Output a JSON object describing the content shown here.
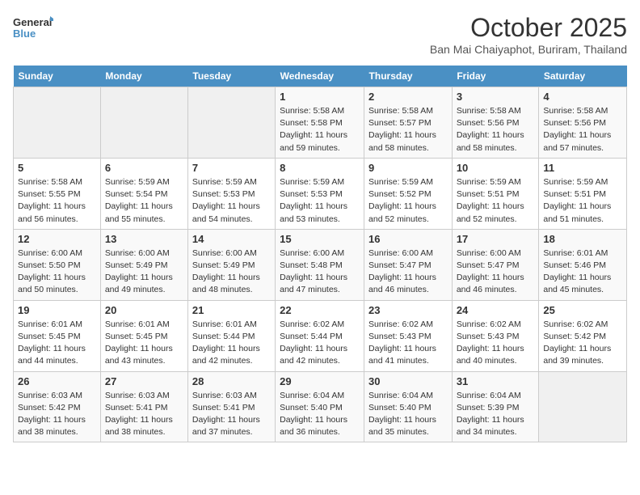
{
  "logo": {
    "line1": "General",
    "line2": "Blue"
  },
  "title": "October 2025",
  "location": "Ban Mai Chaiyaphot, Buriram, Thailand",
  "weekdays": [
    "Sunday",
    "Monday",
    "Tuesday",
    "Wednesday",
    "Thursday",
    "Friday",
    "Saturday"
  ],
  "weeks": [
    [
      {
        "day": "",
        "info": ""
      },
      {
        "day": "",
        "info": ""
      },
      {
        "day": "",
        "info": ""
      },
      {
        "day": "1",
        "info": "Sunrise: 5:58 AM\nSunset: 5:58 PM\nDaylight: 11 hours\nand 59 minutes."
      },
      {
        "day": "2",
        "info": "Sunrise: 5:58 AM\nSunset: 5:57 PM\nDaylight: 11 hours\nand 58 minutes."
      },
      {
        "day": "3",
        "info": "Sunrise: 5:58 AM\nSunset: 5:56 PM\nDaylight: 11 hours\nand 58 minutes."
      },
      {
        "day": "4",
        "info": "Sunrise: 5:58 AM\nSunset: 5:56 PM\nDaylight: 11 hours\nand 57 minutes."
      }
    ],
    [
      {
        "day": "5",
        "info": "Sunrise: 5:58 AM\nSunset: 5:55 PM\nDaylight: 11 hours\nand 56 minutes."
      },
      {
        "day": "6",
        "info": "Sunrise: 5:59 AM\nSunset: 5:54 PM\nDaylight: 11 hours\nand 55 minutes."
      },
      {
        "day": "7",
        "info": "Sunrise: 5:59 AM\nSunset: 5:53 PM\nDaylight: 11 hours\nand 54 minutes."
      },
      {
        "day": "8",
        "info": "Sunrise: 5:59 AM\nSunset: 5:53 PM\nDaylight: 11 hours\nand 53 minutes."
      },
      {
        "day": "9",
        "info": "Sunrise: 5:59 AM\nSunset: 5:52 PM\nDaylight: 11 hours\nand 52 minutes."
      },
      {
        "day": "10",
        "info": "Sunrise: 5:59 AM\nSunset: 5:51 PM\nDaylight: 11 hours\nand 52 minutes."
      },
      {
        "day": "11",
        "info": "Sunrise: 5:59 AM\nSunset: 5:51 PM\nDaylight: 11 hours\nand 51 minutes."
      }
    ],
    [
      {
        "day": "12",
        "info": "Sunrise: 6:00 AM\nSunset: 5:50 PM\nDaylight: 11 hours\nand 50 minutes."
      },
      {
        "day": "13",
        "info": "Sunrise: 6:00 AM\nSunset: 5:49 PM\nDaylight: 11 hours\nand 49 minutes."
      },
      {
        "day": "14",
        "info": "Sunrise: 6:00 AM\nSunset: 5:49 PM\nDaylight: 11 hours\nand 48 minutes."
      },
      {
        "day": "15",
        "info": "Sunrise: 6:00 AM\nSunset: 5:48 PM\nDaylight: 11 hours\nand 47 minutes."
      },
      {
        "day": "16",
        "info": "Sunrise: 6:00 AM\nSunset: 5:47 PM\nDaylight: 11 hours\nand 46 minutes."
      },
      {
        "day": "17",
        "info": "Sunrise: 6:00 AM\nSunset: 5:47 PM\nDaylight: 11 hours\nand 46 minutes."
      },
      {
        "day": "18",
        "info": "Sunrise: 6:01 AM\nSunset: 5:46 PM\nDaylight: 11 hours\nand 45 minutes."
      }
    ],
    [
      {
        "day": "19",
        "info": "Sunrise: 6:01 AM\nSunset: 5:45 PM\nDaylight: 11 hours\nand 44 minutes."
      },
      {
        "day": "20",
        "info": "Sunrise: 6:01 AM\nSunset: 5:45 PM\nDaylight: 11 hours\nand 43 minutes."
      },
      {
        "day": "21",
        "info": "Sunrise: 6:01 AM\nSunset: 5:44 PM\nDaylight: 11 hours\nand 42 minutes."
      },
      {
        "day": "22",
        "info": "Sunrise: 6:02 AM\nSunset: 5:44 PM\nDaylight: 11 hours\nand 42 minutes."
      },
      {
        "day": "23",
        "info": "Sunrise: 6:02 AM\nSunset: 5:43 PM\nDaylight: 11 hours\nand 41 minutes."
      },
      {
        "day": "24",
        "info": "Sunrise: 6:02 AM\nSunset: 5:43 PM\nDaylight: 11 hours\nand 40 minutes."
      },
      {
        "day": "25",
        "info": "Sunrise: 6:02 AM\nSunset: 5:42 PM\nDaylight: 11 hours\nand 39 minutes."
      }
    ],
    [
      {
        "day": "26",
        "info": "Sunrise: 6:03 AM\nSunset: 5:42 PM\nDaylight: 11 hours\nand 38 minutes."
      },
      {
        "day": "27",
        "info": "Sunrise: 6:03 AM\nSunset: 5:41 PM\nDaylight: 11 hours\nand 38 minutes."
      },
      {
        "day": "28",
        "info": "Sunrise: 6:03 AM\nSunset: 5:41 PM\nDaylight: 11 hours\nand 37 minutes."
      },
      {
        "day": "29",
        "info": "Sunrise: 6:04 AM\nSunset: 5:40 PM\nDaylight: 11 hours\nand 36 minutes."
      },
      {
        "day": "30",
        "info": "Sunrise: 6:04 AM\nSunset: 5:40 PM\nDaylight: 11 hours\nand 35 minutes."
      },
      {
        "day": "31",
        "info": "Sunrise: 6:04 AM\nSunset: 5:39 PM\nDaylight: 11 hours\nand 34 minutes."
      },
      {
        "day": "",
        "info": ""
      }
    ]
  ]
}
